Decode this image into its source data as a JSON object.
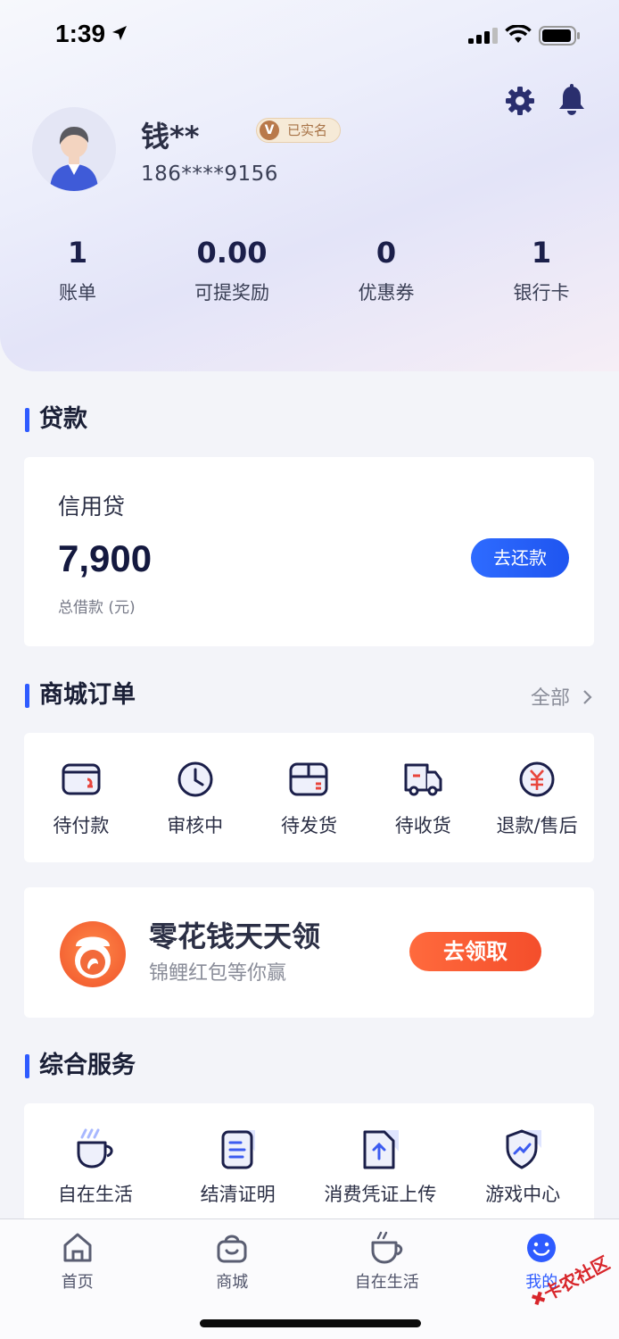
{
  "status_bar": {
    "time": "1:39"
  },
  "profile": {
    "name": "钱**",
    "verified_badge": "已实名",
    "verified_letter": "V",
    "phone": "186****9156"
  },
  "stats": [
    {
      "value": "1",
      "label": "账单"
    },
    {
      "value": "0.00",
      "label": "可提奖励"
    },
    {
      "value": "0",
      "label": "优惠券"
    },
    {
      "value": "1",
      "label": "银行卡"
    }
  ],
  "loan": {
    "section_title": "贷款",
    "type": "信用贷",
    "amount": "7,900",
    "subtitle": "总借款 (元)",
    "button": "去还款"
  },
  "orders": {
    "section_title": "商城订单",
    "see_all": "全部",
    "items": [
      {
        "label": "待付款",
        "icon": "wallet-icon"
      },
      {
        "label": "审核中",
        "icon": "clock-icon"
      },
      {
        "label": "待发货",
        "icon": "box-icon"
      },
      {
        "label": "待收货",
        "icon": "truck-icon"
      },
      {
        "label": "退款/售后",
        "icon": "yuan-refund-icon"
      }
    ]
  },
  "promo": {
    "title": "零花钱天天领",
    "subtitle": "锦鲤红包等你赢",
    "button": "去领取"
  },
  "services": {
    "section_title": "综合服务",
    "items": [
      {
        "label": "自在生活",
        "icon": "coffee-cup-icon"
      },
      {
        "label": "结清证明",
        "icon": "document-icon"
      },
      {
        "label": "消费凭证上传",
        "icon": "upload-file-icon"
      },
      {
        "label": "游戏中心",
        "icon": "shield-icon"
      }
    ]
  },
  "tabbar": {
    "items": [
      {
        "label": "首页",
        "icon": "home-icon",
        "active": false
      },
      {
        "label": "商城",
        "icon": "shopping-bag-icon",
        "active": false
      },
      {
        "label": "自在生活",
        "icon": "coffee-cup-icon",
        "active": false
      },
      {
        "label": "我的",
        "icon": "smiley-icon",
        "active": true
      }
    ]
  },
  "watermark": "卡农社区",
  "colors": {
    "accent": "#2e5bff",
    "promo": "#f44e2b",
    "badge": "#b9794a"
  }
}
